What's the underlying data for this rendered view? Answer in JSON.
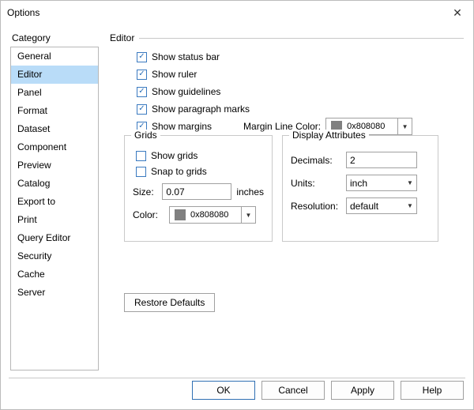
{
  "window": {
    "title": "Options"
  },
  "category": {
    "label": "Category",
    "items": [
      "General",
      "Editor",
      "Panel",
      "Format",
      "Dataset",
      "Component",
      "Preview",
      "Catalog",
      "Export to",
      "Print",
      "Query Editor",
      "Security",
      "Cache",
      "Server"
    ],
    "selected": "Editor"
  },
  "section": {
    "title": "Editor"
  },
  "checks": {
    "status_bar": "Show status bar",
    "ruler": "Show ruler",
    "guidelines": "Show guidelines",
    "paragraph": "Show paragraph marks",
    "margins": "Show margins"
  },
  "margin_line_color": {
    "label": "Margin Line Color:",
    "value": "0x808080",
    "swatch": "#808080"
  },
  "grids": {
    "legend": "Grids",
    "show": "Show grids",
    "snap": "Snap to grids",
    "size_label": "Size:",
    "size_value": "0.07",
    "size_unit": "inches",
    "color_label": "Color:",
    "color_value": "0x808080",
    "color_swatch": "#808080"
  },
  "display": {
    "legend": "Display Attributes",
    "decimals_label": "Decimals:",
    "decimals_value": "2",
    "units_label": "Units:",
    "units_value": "inch",
    "resolution_label": "Resolution:",
    "resolution_value": "default"
  },
  "restore": "Restore Defaults",
  "buttons": {
    "ok": "OK",
    "cancel": "Cancel",
    "apply": "Apply",
    "help": "Help"
  }
}
